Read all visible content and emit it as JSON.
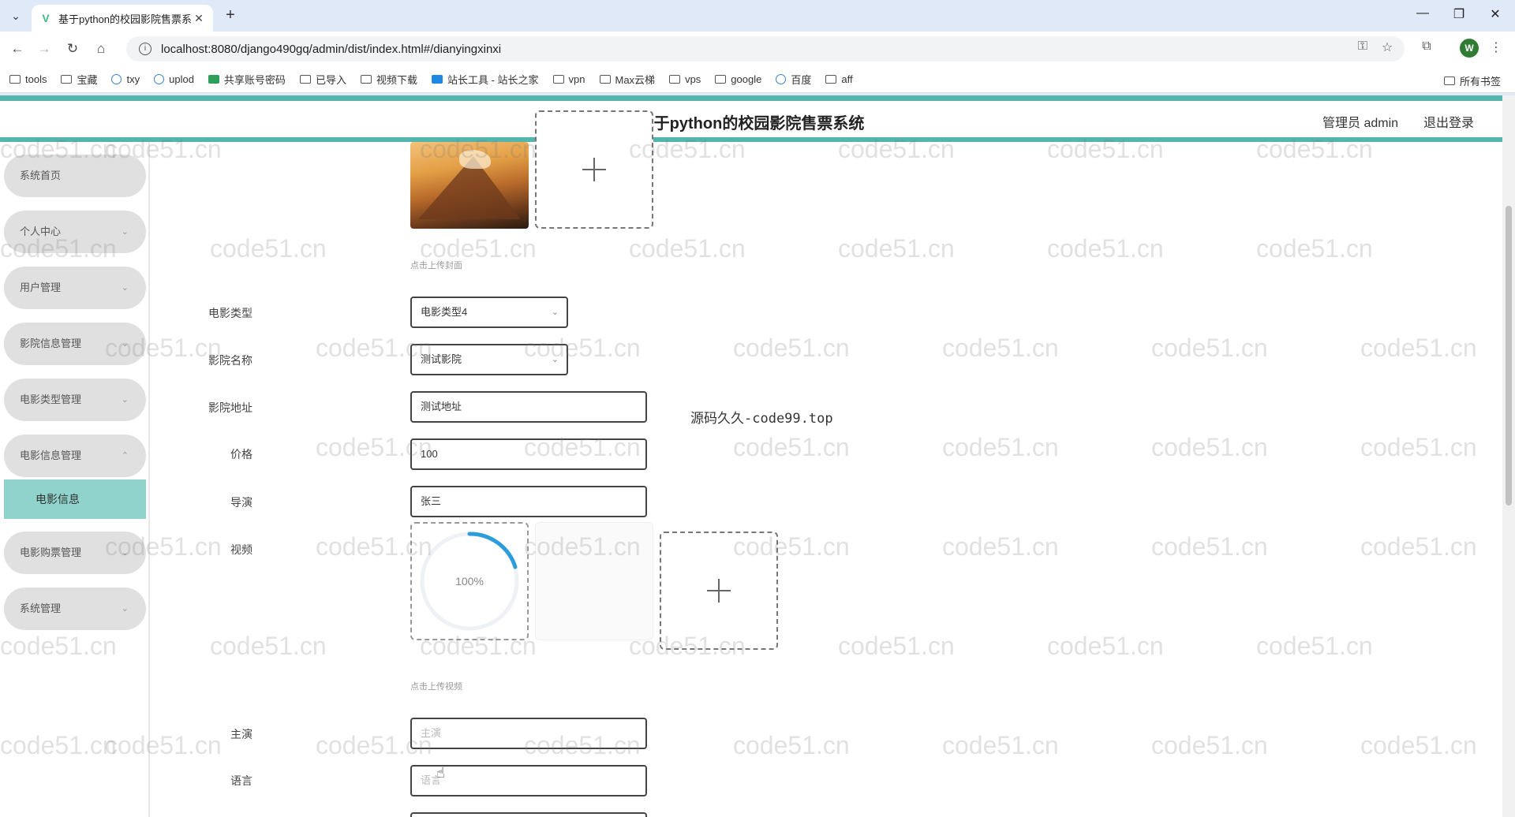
{
  "browser": {
    "tab_title": "基于python的校园影院售票系",
    "url": "localhost:8080/django490gq/admin/dist/index.html#/dianyingxinxi",
    "bookmarks": [
      "tools",
      "宝藏",
      "txy",
      "uplod",
      "共享账号密码",
      "已导入",
      "视频下载",
      "站长工具 - 站长之家",
      "vpn",
      "Max云梯",
      "vps",
      "google",
      "百度",
      "aff"
    ],
    "all_bookmarks": "所有书签",
    "profile_initial": "W"
  },
  "header": {
    "title": "基于python的校园影院售票系统",
    "admin": "管理员 admin",
    "logout": "退出登录"
  },
  "sidebar": {
    "items": [
      {
        "label": "系统首页",
        "chevron": false
      },
      {
        "label": "个人中心",
        "chevron": true
      },
      {
        "label": "用户管理",
        "chevron": true
      },
      {
        "label": "影院信息管理",
        "chevron": true
      },
      {
        "label": "电影类型管理",
        "chevron": true
      },
      {
        "label": "电影信息管理",
        "chevron": true
      },
      {
        "label": "电影购票管理",
        "chevron": true
      },
      {
        "label": "系统管理",
        "chevron": true
      }
    ],
    "active_sub": "电影信息"
  },
  "form": {
    "cover_hint": "点击上传封面",
    "movie_type_label": "电影类型",
    "movie_type_value": "电影类型4",
    "cinema_name_label": "影院名称",
    "cinema_name_value": "测试影院",
    "cinema_addr_label": "影院地址",
    "cinema_addr_value": "测试地址",
    "price_label": "价格",
    "price_value": "100",
    "director_label": "导演",
    "director_value": "张三",
    "video_label": "视频",
    "video_progress": "100%",
    "video_hint": "点击上传视频",
    "actor_label": "主演",
    "actor_placeholder": "主演",
    "language_label": "语言",
    "language_placeholder": "语言"
  },
  "overlay_note": "源码久久-code99.top",
  "watermark_text": "code51.cn",
  "colors": {
    "accent": "#55b5ad",
    "active_sub": "#8fd3cc",
    "menu_bg": "#e0e0e0"
  }
}
